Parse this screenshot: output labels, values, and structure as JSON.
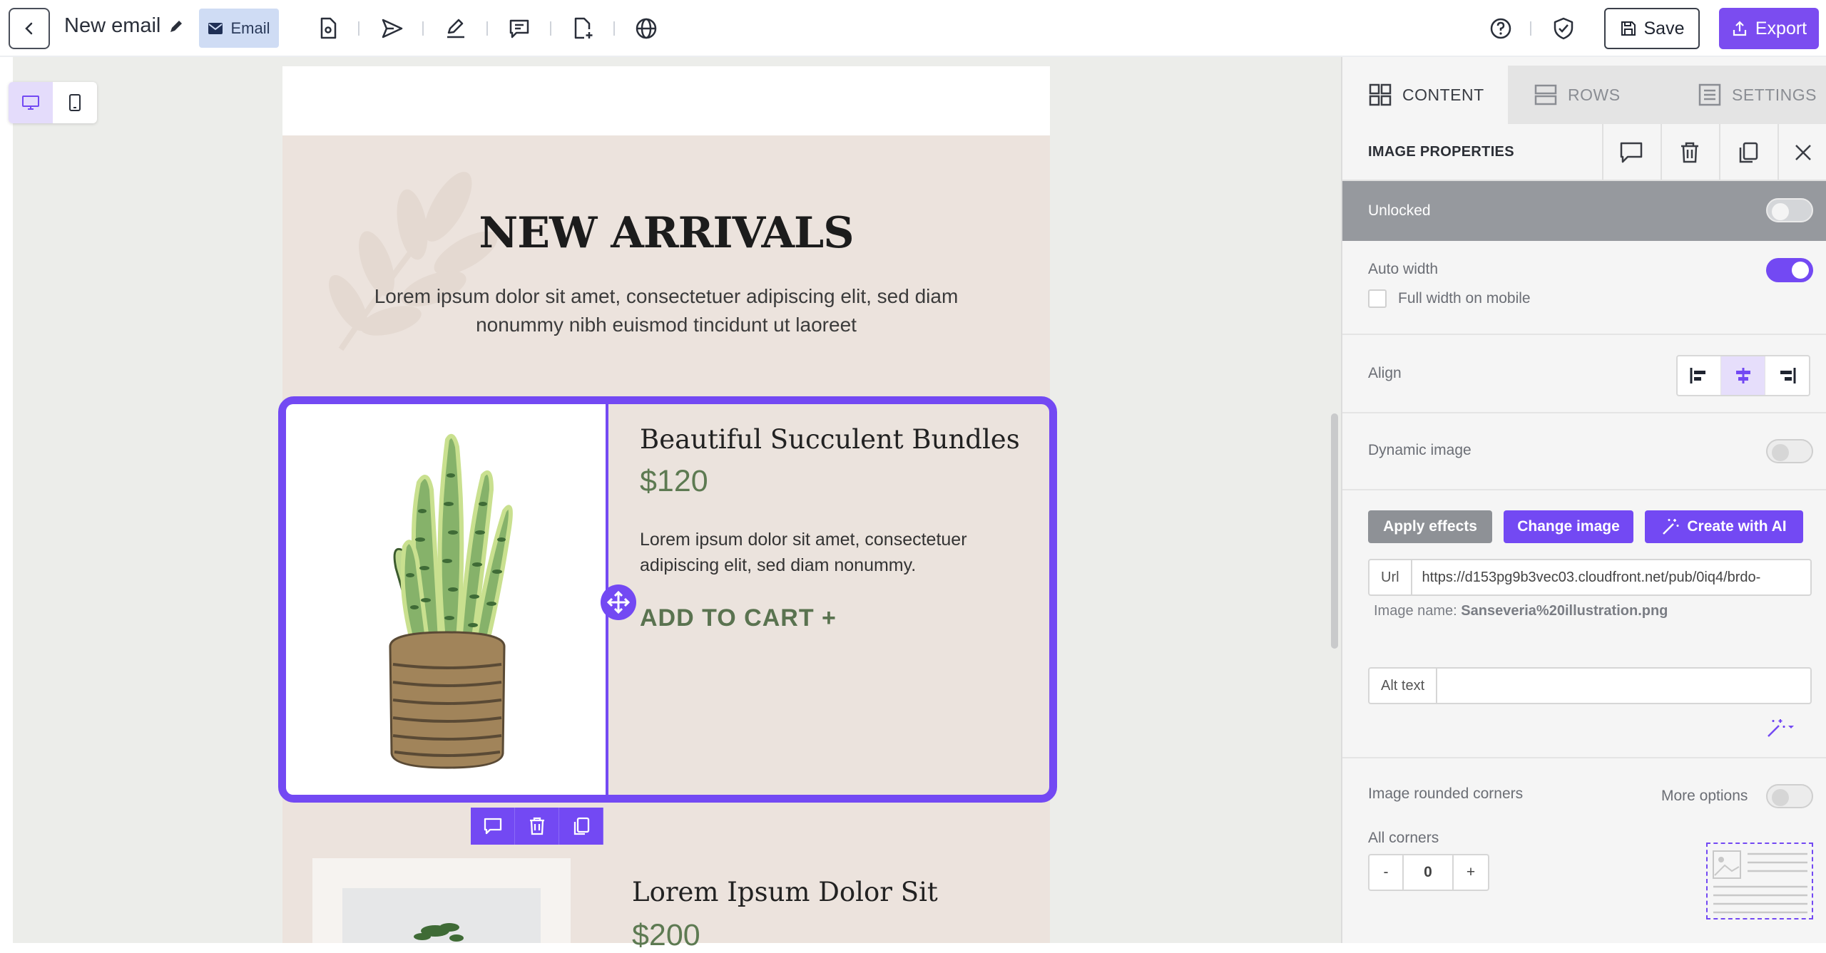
{
  "topbar": {
    "doc_title": "New email",
    "email_badge": "Email",
    "save_label": "Save",
    "export_label": "Export"
  },
  "email": {
    "hero_title": "NEW ARRIVALS",
    "hero_text": "Lorem ipsum dolor sit amet, consectetuer adipiscing elit, sed diam nonummy nibh euismod tincidunt ut laoreet",
    "product1": {
      "title": "Beautiful Succulent Bundles",
      "price": "$120",
      "desc": "Lorem ipsum dolor sit amet, consectetuer adipiscing elit, sed diam nonummy.",
      "cta": "ADD TO CART +"
    },
    "product2": {
      "title": "Lorem Ipsum Dolor Sit",
      "price": "$200"
    }
  },
  "panel": {
    "tabs": [
      {
        "label": "CONTENT",
        "icon": "grid-icon"
      },
      {
        "label": "ROWS",
        "icon": "rows-icon"
      },
      {
        "label": "SETTINGS",
        "icon": "settings-icon"
      }
    ],
    "props_title": "IMAGE PROPERTIES",
    "unlocked_label": "Unlocked",
    "auto_width_label": "Auto width",
    "full_width_mobile_label": "Full width on mobile",
    "align_label": "Align",
    "dynamic_image_label": "Dynamic image",
    "apply_effects_label": "Apply effects",
    "change_image_label": "Change image",
    "create_ai_label": "Create with AI",
    "url_label": "Url",
    "url_value": "https://d153pg9b3vec03.cloudfront.net/pub/0iq4/brdo-",
    "image_name_prefix": "Image name:",
    "image_name": "Sanseveria%20illustration.png",
    "alt_text_label": "Alt text",
    "alt_text_value": "",
    "rounded_label": "Image rounded corners",
    "more_options_label": "More options",
    "all_corners_label": "All corners",
    "corners_value": "0",
    "minus": "-",
    "plus": "+"
  },
  "colors": {
    "accent": "#7349f3",
    "product_green": "#5d7a52",
    "email_bg": "#ece3dd",
    "canvas_bg": "#ecedea"
  }
}
